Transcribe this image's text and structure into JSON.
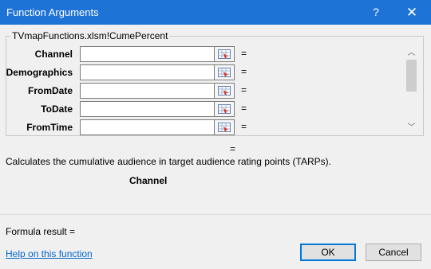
{
  "window": {
    "title": "Function Arguments",
    "help_glyph": "?",
    "close_glyph": "✕"
  },
  "function_group": {
    "label": "TVmapFunctions.xlsm!CumePercent",
    "arguments": [
      {
        "label": "Channel",
        "value": "",
        "result": "="
      },
      {
        "label": "Demographics",
        "value": "",
        "result": "="
      },
      {
        "label": "FromDate",
        "value": "",
        "result": "="
      },
      {
        "label": "ToDate",
        "value": "",
        "result": "="
      },
      {
        "label": "FromTime",
        "value": "",
        "result": "="
      }
    ],
    "scroll_up_glyph": "︿",
    "scroll_down_glyph": "﹀"
  },
  "function_result_eq": "=",
  "description": "Calculates the cumulative audience in target audience rating points (TARPs).",
  "argument_description_name": "Channel",
  "formula_result": "Formula result =",
  "help_link": "Help on this function",
  "buttons": {
    "ok": "OK",
    "cancel": "Cancel"
  }
}
